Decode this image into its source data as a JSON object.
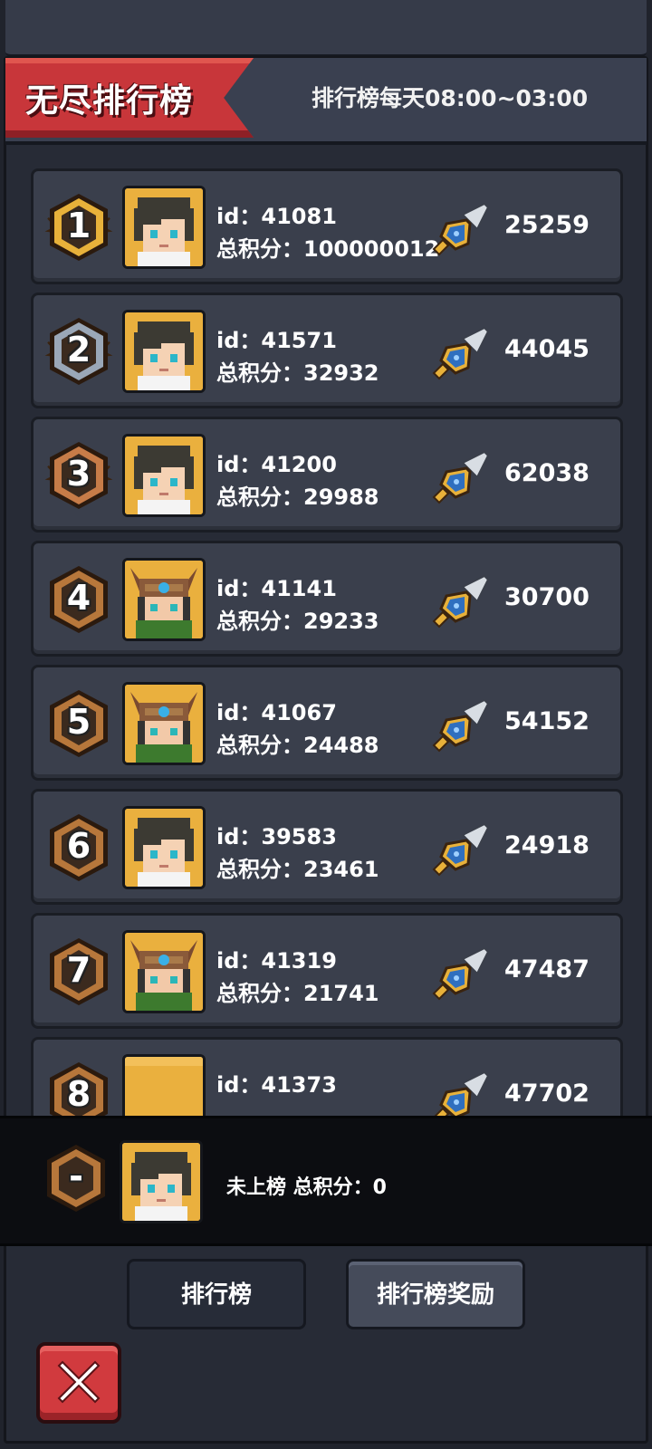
{
  "header": {
    "title": "无尽排行榜",
    "schedule": "排行榜每天08:00~03:00"
  },
  "rows": [
    {
      "rank": "1",
      "avatar": "hero",
      "id": "id：41081",
      "score": "总积分：1000000122",
      "power": "25259"
    },
    {
      "rank": "2",
      "avatar": "hero",
      "id": "id：41571",
      "score": "总积分：32932",
      "power": "44045"
    },
    {
      "rank": "3",
      "avatar": "hero",
      "id": "id：41200",
      "score": "总积分：29988",
      "power": "62038"
    },
    {
      "rank": "4",
      "avatar": "horned",
      "id": "id：41141",
      "score": "总积分：29233",
      "power": "30700"
    },
    {
      "rank": "5",
      "avatar": "horned",
      "id": "id：41067",
      "score": "总积分：24488",
      "power": "54152"
    },
    {
      "rank": "6",
      "avatar": "hero",
      "id": "id：39583",
      "score": "总积分：23461",
      "power": "24918"
    },
    {
      "rank": "7",
      "avatar": "horned",
      "id": "id：41319",
      "score": "总积分：21741",
      "power": "47487"
    },
    {
      "rank": "8",
      "avatar": "blank",
      "id": "id：41373",
      "score": "",
      "power": "47702"
    }
  ],
  "me": {
    "rank": "-",
    "text": "未上榜 总积分：0"
  },
  "buttons": {
    "leaderboard": "排行榜",
    "rewards": "排行榜奖励"
  },
  "icons": {
    "rank_badge": "hexagon-badge-icon",
    "power": "sword-shield-icon",
    "close": "close-x-icon"
  },
  "colors": {
    "gold": "#e8b13a",
    "silver": "#9aa7b7",
    "bronze": "#c77c48",
    "badge": "#b7773b",
    "title_red": "#c8363a"
  }
}
